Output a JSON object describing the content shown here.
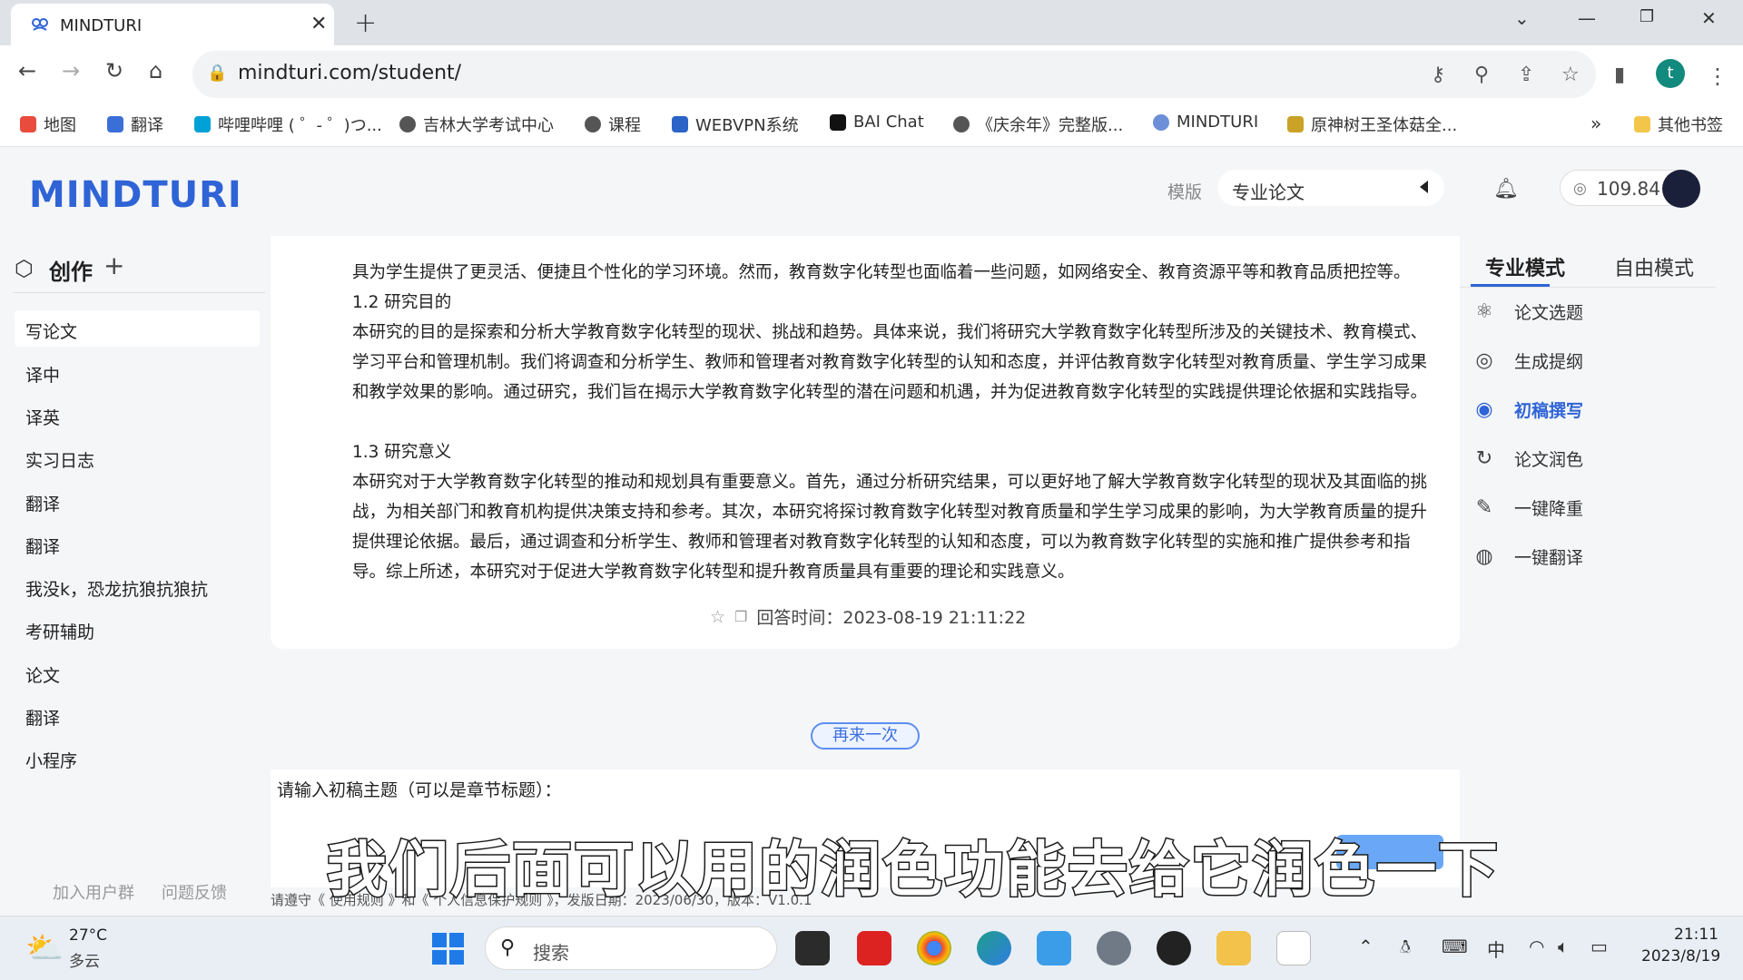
{
  "browser": {
    "tab_title": "MINDTURI",
    "url": "mindturi.com/student/",
    "profile_initial": "t",
    "bookmarks": [
      "地图",
      "翻译",
      "哔哩哔哩 ( ゜- ゜)つ...",
      "吉林大学考试中心",
      "课程",
      "WEBVPN系统",
      "BAI Chat",
      "《庆余年》完整版...",
      "MINDTURI",
      "原神树王圣体菇全..."
    ],
    "other_bookmarks": "其他书签"
  },
  "header": {
    "logo": "MINDTURI",
    "template_label": "模版",
    "template_value": "专业论文",
    "credits": "109.84"
  },
  "sidebar": {
    "create_label": "创作",
    "items": [
      "写论文",
      "译中",
      "译英",
      "实习日志",
      "翻译",
      "翻译",
      "我没k，恐龙抗狼抗狼抗",
      "考研辅助",
      "论文",
      "翻译",
      "小程序"
    ],
    "footer_join": "加入用户群",
    "footer_feedback": "问题反馈"
  },
  "content": {
    "paragraphs": [
      "具为学生提供了更灵活、便捷且个性化的学习环境。然而，教育数字化转型也面临着一些问题，如网络安全、教育资源平等和教育品质把控等。",
      "1.2 研究目的",
      "本研究的目的是探索和分析大学教育数字化转型的现状、挑战和趋势。具体来说，我们将研究大学教育数字化转型所涉及的关键技术、教育模式、学习平台和管理机制。我们将调查和分析学生、教师和管理者对教育数字化转型的认知和态度，并评估教育数字化转型对教育质量、学生学习成果和教学效果的影响。通过研究，我们旨在揭示大学教育数字化转型的潜在问题和机遇，并为促进教育数字化转型的实践提供理论依据和实践指导。",
      "1.3 研究意义",
      "本研究对于大学教育数字化转型的推动和规划具有重要意义。首先，通过分析研究结果，可以更好地了解大学教育数字化转型的现状及其面临的挑战，为相关部门和教育机构提供决策支持和参考。其次，本研究将探讨教育数字化转型对教育质量和学生学习成果的影响，为大学教育质量的提升提供理论依据。最后，通过调查和分析学生、教师和管理者对教育数字化转型的认知和态度，可以为教育数字化转型的实施和推广提供参考和指导。综上所述，本研究对于促进大学教育数字化转型和提升教育质量具有重要的理论和实践意义。"
    ],
    "answer_time": "回答时间：2023-08-19 21:11:22",
    "retry_label": "再来一次",
    "input_label": "请输入初稿主题（可以是章节标题）：",
    "disclaimer": "请遵守《 使用规则 》和《 个人信息保护规则 》，发版日期：2023/06/30，版本：V1.0.1",
    "caption": "我们后面可以用的润色功能去给它润色一下"
  },
  "right_panel": {
    "mode_pro": "专业模式",
    "mode_free": "自由模式",
    "items": [
      {
        "label": "论文选题",
        "icon": "atom-icon"
      },
      {
        "label": "生成提纲",
        "icon": "target-icon"
      },
      {
        "label": "初稿撰写",
        "icon": "eye-icon"
      },
      {
        "label": "论文润色",
        "icon": "refresh-icon"
      },
      {
        "label": "一键降重",
        "icon": "pen-icon"
      },
      {
        "label": "一键翻译",
        "icon": "globe-icon"
      }
    ],
    "active_index": 2,
    "accent": "#2f64d6"
  },
  "taskbar": {
    "temp": "27°C",
    "weather": "多云",
    "search_placeholder": "搜索",
    "ime": "中",
    "time": "21:11",
    "date": "2023/8/19"
  }
}
